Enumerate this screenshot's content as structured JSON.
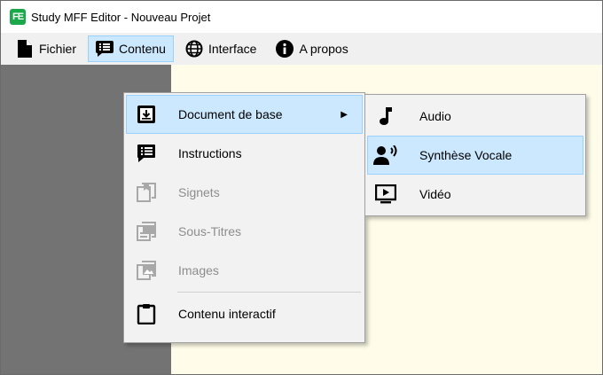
{
  "window": {
    "title": "Study MFF Editor - Nouveau Projet",
    "app_icon_text": "FE",
    "app_icon_color": "#1aa84a"
  },
  "menubar": {
    "items": [
      {
        "label": "Fichier",
        "icon": "file-icon"
      },
      {
        "label": "Contenu",
        "icon": "list-icon"
      },
      {
        "label": "Interface",
        "icon": "globe-icon"
      },
      {
        "label": "A propos",
        "icon": "info-icon"
      }
    ]
  },
  "contenu_menu": {
    "items": [
      {
        "label": "Document de base",
        "icon": "download-box-icon",
        "enabled": true,
        "submenu": true
      },
      {
        "label": "Instructions",
        "icon": "chat-list-icon",
        "enabled": true
      },
      {
        "label": "Signets",
        "icon": "bookmark-icon",
        "enabled": false
      },
      {
        "label": "Sous-Titres",
        "icon": "subtitles-icon",
        "enabled": false
      },
      {
        "label": "Images",
        "icon": "image-icon",
        "enabled": false
      },
      {
        "label": "Contenu interactif",
        "icon": "clipboard-icon",
        "enabled": true
      }
    ]
  },
  "document_submenu": {
    "items": [
      {
        "label": "Audio",
        "icon": "music-note-icon"
      },
      {
        "label": "Synthèse Vocale",
        "icon": "voice-icon"
      },
      {
        "label": "Vidéo",
        "icon": "video-icon"
      }
    ]
  },
  "colors": {
    "highlight": "#cce8ff",
    "left_pane": "#737373",
    "main_pane": "#fffde9",
    "disabled_text": "#8d8d8d"
  }
}
